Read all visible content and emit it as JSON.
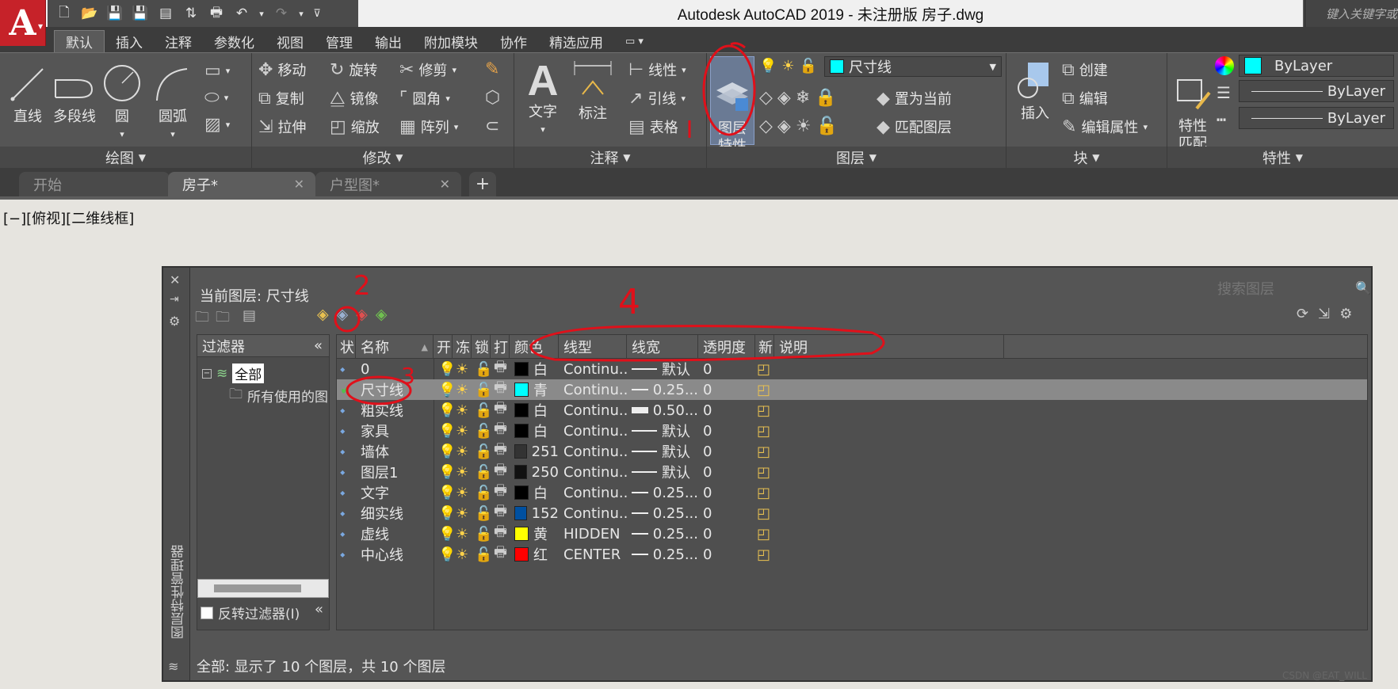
{
  "app": {
    "title": "Autodesk AutoCAD 2019 - 未注册版    房子.dwg",
    "logo_letter": "A",
    "search_placeholder": "键入关键字或短语"
  },
  "ribbon_tabs": [
    "默认",
    "插入",
    "注释",
    "参数化",
    "视图",
    "管理",
    "输出",
    "附加模块",
    "协作",
    "精选应用"
  ],
  "panels": {
    "draw": {
      "title": "绘图",
      "line": "直线",
      "polyline": "多段线",
      "circle": "圆",
      "arc": "圆弧"
    },
    "modify": {
      "title": "修改",
      "move": "移动",
      "rotate": "旋转",
      "trim": "修剪",
      "copy": "复制",
      "mirror": "镜像",
      "fillet": "圆角",
      "stretch": "拉伸",
      "scale": "缩放",
      "array": "阵列"
    },
    "annotation": {
      "title": "注释",
      "text": "文字",
      "dimension": "标注",
      "linear": "线性",
      "leader": "引线",
      "table": "表格"
    },
    "layers": {
      "title": "图层",
      "properties": "图层\n特性",
      "current_layer": "尺寸线",
      "current_color": "#00ffff",
      "set_current": "置为当前",
      "match_layer": "匹配图层"
    },
    "block": {
      "title": "块",
      "insert": "插入",
      "create": "创建",
      "edit": "编辑",
      "edit_attr": "编辑属性"
    },
    "properties": {
      "title": "特性",
      "match": "特性\n匹配",
      "color": "ByLayer",
      "linetype": "ByLayer",
      "lineweight": "ByLayer",
      "color_hex": "#00ffff"
    }
  },
  "doc_tabs": [
    {
      "label": "开始"
    },
    {
      "label": "房子*"
    },
    {
      "label": "户型图*"
    }
  ],
  "viewport_label": "[−][俯视][二维线框]",
  "layer_manager": {
    "side_title": "图层特性管理器",
    "current_layer_text": "当前图层: 尺寸线",
    "search_placeholder": "搜索图层",
    "filter_header": "过滤器",
    "filter_all": "全部",
    "filter_used": "所有使用的图层",
    "invert_filter": "反转过滤器(I)",
    "columns": [
      "状",
      "名称",
      "开",
      "冻",
      "锁",
      "打",
      "颜色",
      "线型",
      "线宽",
      "透明度",
      "新",
      "说明"
    ],
    "layers": [
      {
        "name": "0",
        "color_name": "白",
        "color": "#000000",
        "linetype": "Continu...",
        "lineweight": "默认",
        "transparency": "0",
        "current": false
      },
      {
        "name": "尺寸线",
        "color_name": "青",
        "color": "#00ffff",
        "linetype": "Continu...",
        "lineweight": "0.25...",
        "transparency": "0",
        "current": true
      },
      {
        "name": "粗实线",
        "color_name": "白",
        "color": "#000000",
        "linetype": "Continu...",
        "lineweight": "0.50...",
        "transparency": "0",
        "current": false
      },
      {
        "name": "家具",
        "color_name": "白",
        "color": "#000000",
        "linetype": "Continu...",
        "lineweight": "默认",
        "transparency": "0",
        "current": false
      },
      {
        "name": "墙体",
        "color_name": "251",
        "color": "#333333",
        "linetype": "Continu...",
        "lineweight": "默认",
        "transparency": "0",
        "current": false
      },
      {
        "name": "图层1",
        "color_name": "250",
        "color": "#111111",
        "linetype": "Continu...",
        "lineweight": "默认",
        "transparency": "0",
        "current": false
      },
      {
        "name": "文字",
        "color_name": "白",
        "color": "#000000",
        "linetype": "Continu...",
        "lineweight": "0.25...",
        "transparency": "0",
        "current": false
      },
      {
        "name": "细实线",
        "color_name": "152",
        "color": "#0050a0",
        "linetype": "Continu...",
        "lineweight": "0.25...",
        "transparency": "0",
        "current": false
      },
      {
        "name": "虚线",
        "color_name": "黄",
        "color": "#ffff00",
        "linetype": "HIDDEN",
        "lineweight": "0.25...",
        "transparency": "0",
        "current": false
      },
      {
        "name": "中心线",
        "color_name": "红",
        "color": "#ff0000",
        "linetype": "CENTER",
        "lineweight": "0.25...",
        "transparency": "0",
        "current": false
      }
    ],
    "status": "全部: 显示了 10 个图层，共 10 个图层"
  },
  "annotations": [
    "2",
    "3",
    "4"
  ],
  "watermark": "CSDN @EAT_WILL"
}
